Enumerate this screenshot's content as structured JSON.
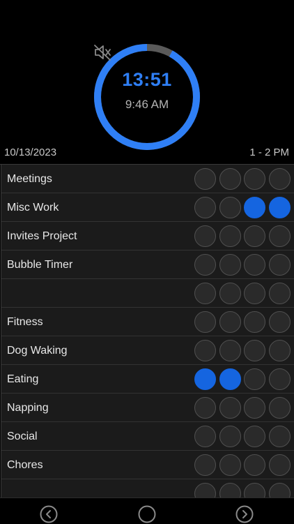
{
  "timer": {
    "countdown": "13:51",
    "clock": "9:46 AM",
    "progress_fraction": 0.92,
    "ring_color": "#2f7ff5",
    "remaining_color": "#5a5a5a",
    "sound_icon": "speaker-muted-icon"
  },
  "header": {
    "date": "10/13/2023",
    "hour_range": "1 - 2 PM"
  },
  "accent_color": "#1565e0",
  "rows": [
    {
      "label": "Meetings",
      "bubbles": [
        false,
        false,
        false,
        false
      ]
    },
    {
      "label": "Misc Work",
      "bubbles": [
        false,
        false,
        true,
        true
      ]
    },
    {
      "label": "Invites Project",
      "bubbles": [
        false,
        false,
        false,
        false
      ]
    },
    {
      "label": "Bubble Timer",
      "bubbles": [
        false,
        false,
        false,
        false
      ]
    },
    {
      "label": "",
      "bubbles": [
        false,
        false,
        false,
        false
      ]
    },
    {
      "label": "Fitness",
      "bubbles": [
        false,
        false,
        false,
        false
      ]
    },
    {
      "label": "Dog Waking",
      "bubbles": [
        false,
        false,
        false,
        false
      ]
    },
    {
      "label": "Eating",
      "bubbles": [
        true,
        true,
        false,
        false
      ]
    },
    {
      "label": "Napping",
      "bubbles": [
        false,
        false,
        false,
        false
      ]
    },
    {
      "label": "Social",
      "bubbles": [
        false,
        false,
        false,
        false
      ]
    },
    {
      "label": "Chores",
      "bubbles": [
        false,
        false,
        false,
        false
      ]
    },
    {
      "label": "",
      "bubbles": [
        false,
        false,
        false,
        false
      ]
    }
  ],
  "nav": {
    "prev_icon": "chevron-left-circle-icon",
    "center_icon": "circle-icon",
    "next_icon": "chevron-right-circle-icon"
  }
}
